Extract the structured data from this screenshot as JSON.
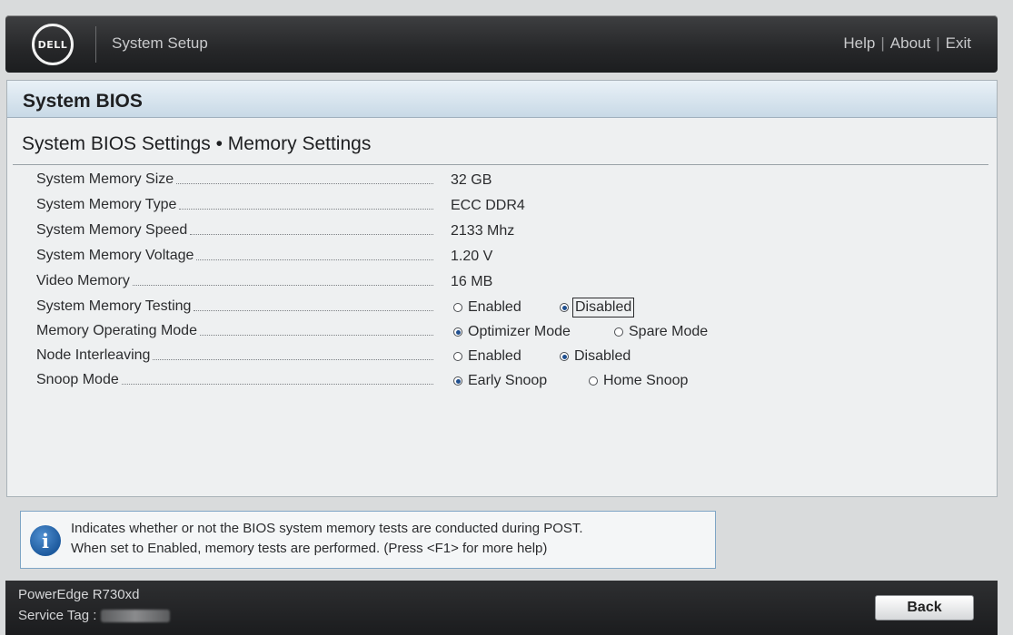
{
  "header": {
    "logo_text": "DELL",
    "app_title": "System Setup",
    "links": [
      "Help",
      "About",
      "Exit"
    ]
  },
  "panel": {
    "title": "System BIOS",
    "subtitle": "System BIOS Settings • Memory Settings"
  },
  "settings": {
    "memory_size": {
      "label": "System Memory Size",
      "value": "32 GB"
    },
    "memory_type": {
      "label": "System Memory Type",
      "value": "ECC DDR4"
    },
    "memory_speed": {
      "label": "System Memory Speed",
      "value": "2133 Mhz"
    },
    "memory_voltage": {
      "label": "System Memory Voltage",
      "value": "1.20 V"
    },
    "video_memory": {
      "label": "Video Memory",
      "value": "16 MB"
    },
    "memory_testing": {
      "label": "System Memory Testing",
      "options": [
        "Enabled",
        "Disabled"
      ],
      "selected": "Disabled"
    },
    "operating_mode": {
      "label": "Memory Operating Mode",
      "options": [
        "Optimizer Mode",
        "Spare Mode"
      ],
      "selected": "Optimizer Mode"
    },
    "node_interleaving": {
      "label": "Node Interleaving",
      "options": [
        "Enabled",
        "Disabled"
      ],
      "selected": "Disabled"
    },
    "snoop_mode": {
      "label": "Snoop Mode",
      "options": [
        "Early Snoop",
        "Home Snoop"
      ],
      "selected": "Early Snoop"
    }
  },
  "help": {
    "line1": "Indicates whether or not the BIOS system memory tests are conducted during POST.",
    "line2": "When set to Enabled, memory tests are performed. (Press <F1> for more help)"
  },
  "footer": {
    "model": "PowerEdge R730xd",
    "service_tag_label": "Service Tag :",
    "back_label": "Back"
  }
}
